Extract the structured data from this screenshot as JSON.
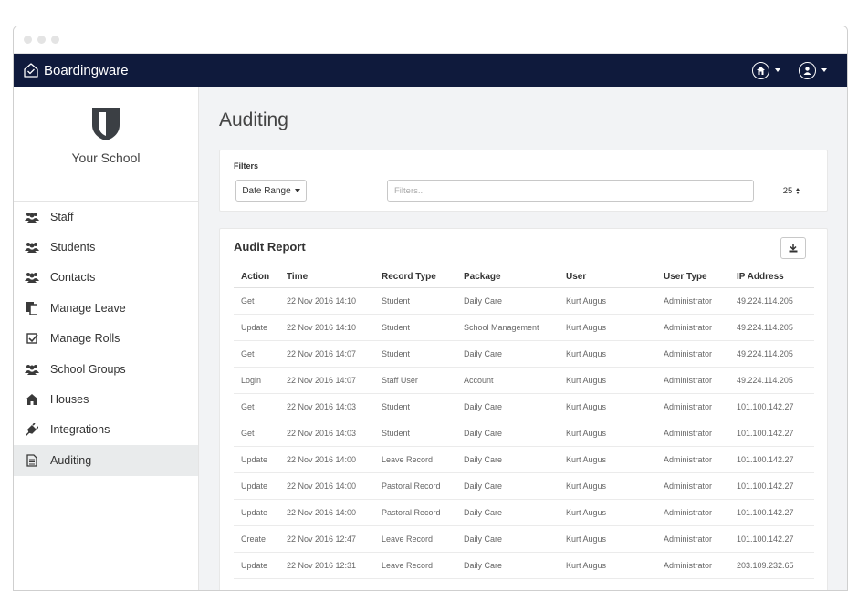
{
  "app": {
    "brand": "Boardingware"
  },
  "sidebar": {
    "school_name": "Your School",
    "items": [
      {
        "label": "Staff",
        "icon": "users-icon"
      },
      {
        "label": "Students",
        "icon": "users-icon"
      },
      {
        "label": "Contacts",
        "icon": "users-icon"
      },
      {
        "label": "Manage Leave",
        "icon": "documents-icon"
      },
      {
        "label": "Manage Rolls",
        "icon": "checkbox-icon"
      },
      {
        "label": "School Groups",
        "icon": "users-icon"
      },
      {
        "label": "Houses",
        "icon": "home-icon"
      },
      {
        "label": "Integrations",
        "icon": "plug-icon"
      },
      {
        "label": "Auditing",
        "icon": "file-icon",
        "active": true
      }
    ]
  },
  "page": {
    "title": "Auditing"
  },
  "filters": {
    "label": "Filters",
    "date_range_label": "Date Range",
    "search_placeholder": "Filters...",
    "page_size": "25"
  },
  "report": {
    "title": "Audit Report",
    "columns": [
      "Action",
      "Time",
      "Record Type",
      "Package",
      "User",
      "User Type",
      "IP Address"
    ],
    "rows": [
      [
        "Get",
        "22 Nov 2016 14:10",
        "Student",
        "Daily Care",
        "Kurt Augus",
        "Administrator",
        "49.224.114.205"
      ],
      [
        "Update",
        "22 Nov 2016 14:10",
        "Student",
        "School Management",
        "Kurt Augus",
        "Administrator",
        "49.224.114.205"
      ],
      [
        "Get",
        "22 Nov 2016 14:07",
        "Student",
        "Daily Care",
        "Kurt Augus",
        "Administrator",
        "49.224.114.205"
      ],
      [
        "Login",
        "22 Nov 2016 14:07",
        "Staff User",
        "Account",
        "Kurt Augus",
        "Administrator",
        "49.224.114.205"
      ],
      [
        "Get",
        "22 Nov 2016 14:03",
        "Student",
        "Daily Care",
        "Kurt Augus",
        "Administrator",
        "101.100.142.27"
      ],
      [
        "Get",
        "22 Nov 2016 14:03",
        "Student",
        "Daily Care",
        "Kurt Augus",
        "Administrator",
        "101.100.142.27"
      ],
      [
        "Update",
        "22 Nov 2016 14:00",
        "Leave Record",
        "Daily Care",
        "Kurt Augus",
        "Administrator",
        "101.100.142.27"
      ],
      [
        "Update",
        "22 Nov 2016 14:00",
        "Pastoral Record",
        "Daily Care",
        "Kurt Augus",
        "Administrator",
        "101.100.142.27"
      ],
      [
        "Update",
        "22 Nov 2016 14:00",
        "Pastoral Record",
        "Daily Care",
        "Kurt Augus",
        "Administrator",
        "101.100.142.27"
      ],
      [
        "Create",
        "22 Nov 2016 12:47",
        "Leave Record",
        "Daily Care",
        "Kurt Augus",
        "Administrator",
        "101.100.142.27"
      ],
      [
        "Update",
        "22 Nov 2016 12:31",
        "Leave Record",
        "Daily Care",
        "Kurt Augus",
        "Administrator",
        "203.109.232.65"
      ]
    ]
  }
}
